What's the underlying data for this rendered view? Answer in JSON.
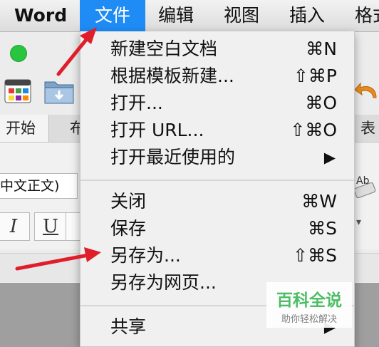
{
  "menubar": {
    "app_name": "Word",
    "items": [
      "文件",
      "编辑",
      "视图",
      "插入",
      "格式"
    ]
  },
  "window": {
    "tabs": [
      "开始",
      "布局",
      "表"
    ],
    "font_value": "中文正文)",
    "italic_label": "I",
    "underline_label": "U"
  },
  "file_menu": {
    "items": [
      {
        "label": "新建空白文档",
        "shortcut": "⌘N"
      },
      {
        "label": "根据模板新建...",
        "shortcut": "⇧⌘P"
      },
      {
        "label": "打开...",
        "shortcut": "⌘O"
      },
      {
        "label": "打开 URL...",
        "shortcut": "⇧⌘O"
      },
      {
        "label": "打开最近使用的",
        "submenu": "▶"
      },
      {
        "label": "关闭",
        "shortcut": "⌘W"
      },
      {
        "label": "保存",
        "shortcut": "⌘S"
      },
      {
        "label": "另存为...",
        "shortcut": "⇧⌘S"
      },
      {
        "label": "另存为网页..."
      },
      {
        "label": "共享",
        "submenu": "▶"
      }
    ]
  },
  "watermark": {
    "title": "百科全说",
    "subtitle": "助你轻松解决"
  },
  "colors": {
    "menu_highlight": "#1f8cf5",
    "arrow": "#e01e2b",
    "traffic_green": "#2bc440",
    "watermark_green": "#3fba5a"
  }
}
